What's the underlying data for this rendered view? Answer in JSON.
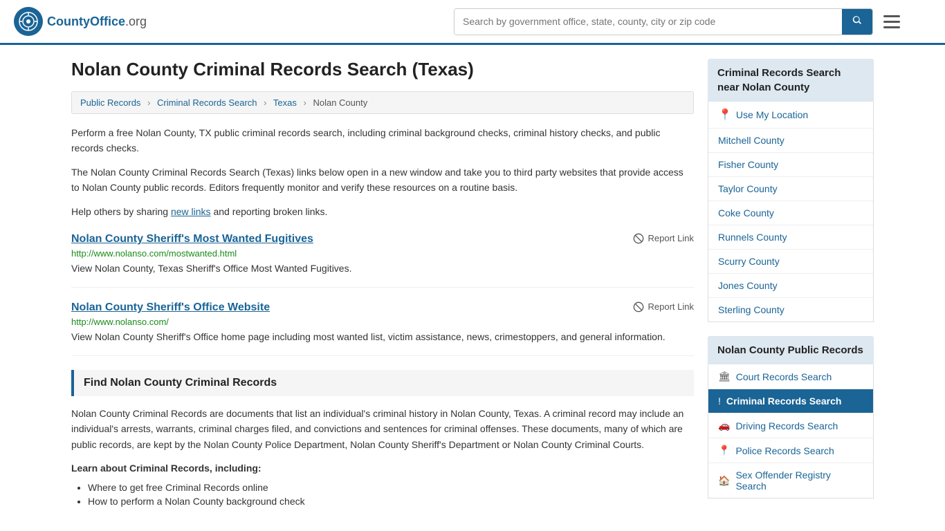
{
  "header": {
    "logo_text": "CountyOffice",
    "logo_suffix": ".org",
    "search_placeholder": "Search by government office, state, county, city or zip code"
  },
  "page": {
    "title": "Nolan County Criminal Records Search (Texas)"
  },
  "breadcrumb": {
    "items": [
      "Public Records",
      "Criminal Records Search",
      "Texas",
      "Nolan County"
    ]
  },
  "intro": {
    "para1": "Perform a free Nolan County, TX public criminal records search, including criminal background checks, criminal history checks, and public records checks.",
    "para2": "The Nolan County Criminal Records Search (Texas) links below open in a new window and take you to third party websites that provide access to Nolan County public records. Editors frequently monitor and verify these resources on a routine basis.",
    "para3_pre": "Help others by sharing ",
    "para3_link": "new links",
    "para3_post": " and reporting broken links."
  },
  "records": [
    {
      "title": "Nolan County Sheriff's Most Wanted Fugitives",
      "url": "http://www.nolanso.com/mostwanted.html",
      "desc": "View Nolan County, Texas Sheriff's Office Most Wanted Fugitives.",
      "report_label": "Report Link"
    },
    {
      "title": "Nolan County Sheriff's Office Website",
      "url": "http://www.nolanso.com/",
      "desc": "View Nolan County Sheriff's Office home page including most wanted list, victim assistance, news, crimestoppers, and general information.",
      "report_label": "Report Link"
    }
  ],
  "find_section": {
    "header": "Find Nolan County Criminal Records",
    "body": "Nolan County Criminal Records are documents that list an individual's criminal history in Nolan County, Texas. A criminal record may include an individual's arrests, warrants, criminal charges filed, and convictions and sentences for criminal offenses. These documents, many of which are public records, are kept by the Nolan County Police Department, Nolan County Sheriff's Department or Nolan County Criminal Courts.",
    "learn_title": "Learn about Criminal Records, including:",
    "bullets": [
      "Where to get free Criminal Records online",
      "How to perform a Nolan County background check"
    ]
  },
  "sidebar": {
    "nearby_header": "Criminal Records Search near Nolan County",
    "use_location_label": "Use My Location",
    "nearby_counties": [
      "Mitchell County",
      "Fisher County",
      "Taylor County",
      "Coke County",
      "Runnels County",
      "Scurry County",
      "Jones County",
      "Sterling County"
    ],
    "public_records_header": "Nolan County Public Records",
    "public_records_items": [
      {
        "label": "Court Records Search",
        "icon": "🏛",
        "active": false
      },
      {
        "label": "Criminal Records Search",
        "icon": "!",
        "active": true
      },
      {
        "label": "Driving Records Search",
        "icon": "🚗",
        "active": false
      },
      {
        "label": "Police Records Search",
        "icon": "📍",
        "active": false
      },
      {
        "label": "Sex Offender Registry Search",
        "icon": "🏠",
        "active": false
      }
    ]
  }
}
